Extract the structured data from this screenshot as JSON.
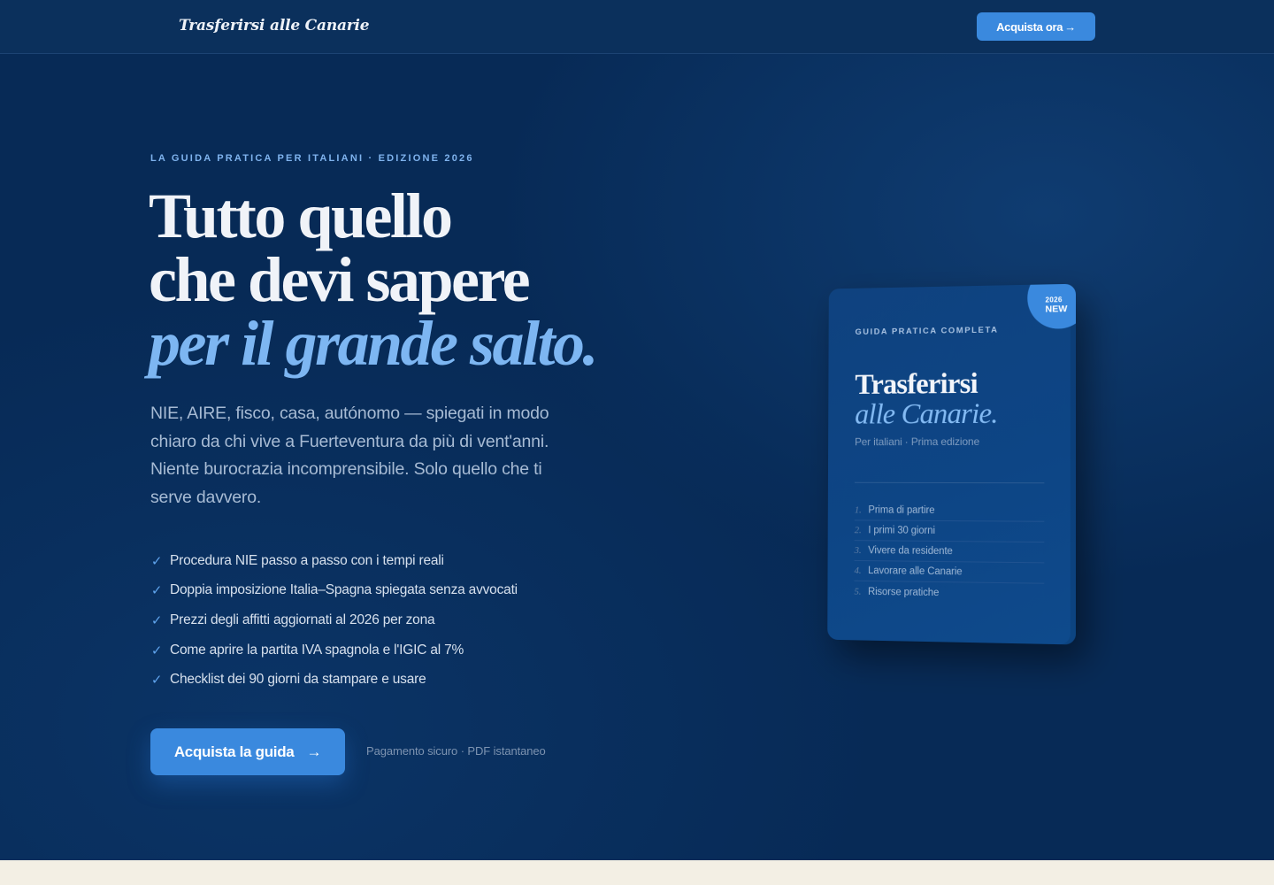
{
  "nav": {
    "brand": "Trasferirsi alle Canarie",
    "cta_label": "Acquista ora",
    "cta_arrow": "→"
  },
  "hero": {
    "eyebrow": "LA GUIDA PRATICA PER ITALIANI · EDIZIONE 2026",
    "headline_line1": "Tutto quello",
    "headline_line2": "che devi sapere",
    "headline_accent": "per il grande salto.",
    "lead": "NIE, AIRE, fisco, casa, autónomo — spiegati in modo chiaro da chi vive a Fuerteventura da più di vent'anni. Niente burocrazia incomprensibile. Solo quello che ti serve davvero.",
    "check_glyph": "✓",
    "features": [
      "Procedura NIE passo a passo con i tempi reali",
      "Doppia imposizione Italia–Spagna spiegata senza avvocati",
      "Prezzi degli affitti aggiornati al 2026 per zona",
      "Come aprire la partita IVA spagnola e l'IGIC al 7%",
      "Checklist dei 90 giorni da stampare e usare"
    ],
    "cta_label": "Acquista la guida",
    "cta_arrow": "→",
    "trust_text": "Pagamento sicuro · PDF istantaneo"
  },
  "book": {
    "badge_year": "2026",
    "badge_label": "NEW",
    "eyebrow": "GUIDA PRATICA COMPLETA",
    "title": "Trasferirsi",
    "title_accent": "alle Canarie.",
    "subtitle": "Per italiani · Prima edizione",
    "toc": [
      {
        "num": "1.",
        "label": "Prima di partire"
      },
      {
        "num": "2.",
        "label": "I primi 30 giorni"
      },
      {
        "num": "3.",
        "label": "Vivere da residente"
      },
      {
        "num": "4.",
        "label": "Lavorare alle Canarie"
      },
      {
        "num": "5.",
        "label": "Risorse pratiche"
      }
    ]
  },
  "colors": {
    "hero_bg": "#072a56",
    "accent": "#3a89de",
    "accent_text": "#7db6f2",
    "footer_bg": "#f3efe4"
  }
}
